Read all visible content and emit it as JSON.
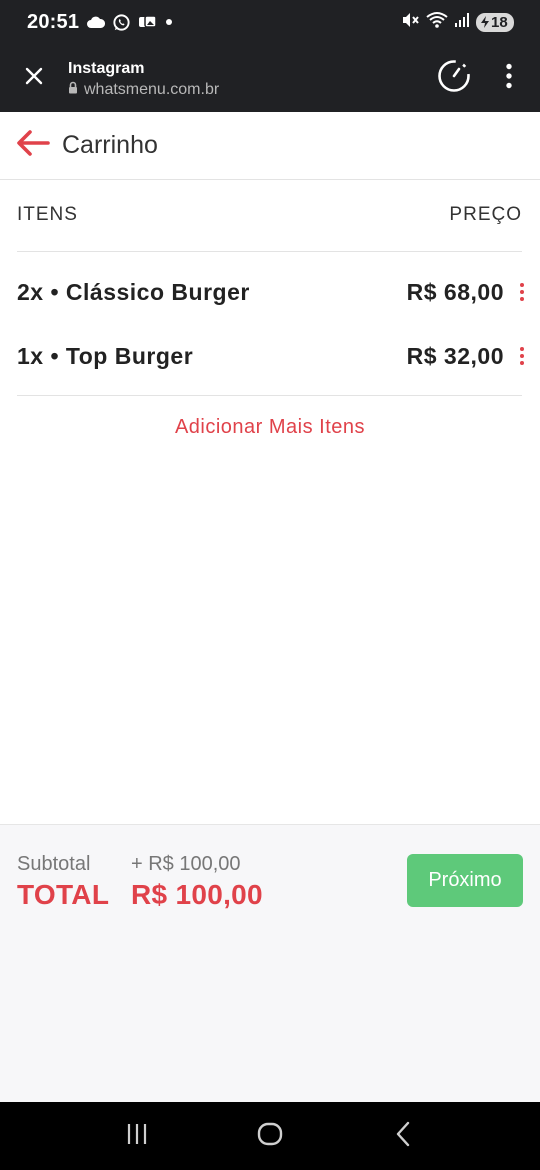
{
  "status_bar": {
    "time": "20:51",
    "battery": "18",
    "icons": [
      "cloud-icon",
      "whatsapp-icon",
      "photos-icon",
      "dot-icon",
      "mute-icon",
      "wifi-icon",
      "signal-icon",
      "battery-icon"
    ]
  },
  "browser": {
    "title": "Instagram",
    "url": "whatsmenu.com.br",
    "icons": [
      "close-icon",
      "lock-icon",
      "timer-icon",
      "more-vert-icon"
    ]
  },
  "page": {
    "title": "Carrinho",
    "columns": {
      "items": "ITENS",
      "price": "PREÇO"
    },
    "items": [
      {
        "label": "2x • Clássico Burger",
        "price": "R$ 68,00"
      },
      {
        "label": "1x • Top Burger",
        "price": "R$ 32,00"
      }
    ],
    "add_more": "Adicionar Mais Itens"
  },
  "summary": {
    "subtotal_label": "Subtotal",
    "subtotal_value": "+ R$ 100,00",
    "total_label": "TOTAL",
    "total_value": "R$ 100,00",
    "next_label": "Próximo"
  },
  "colors": {
    "accent": "#e0424a",
    "next_button": "#5ec97a",
    "toolbar": "#202124"
  },
  "nav": {
    "icons": [
      "recents-icon",
      "home-icon",
      "back-icon"
    ]
  }
}
